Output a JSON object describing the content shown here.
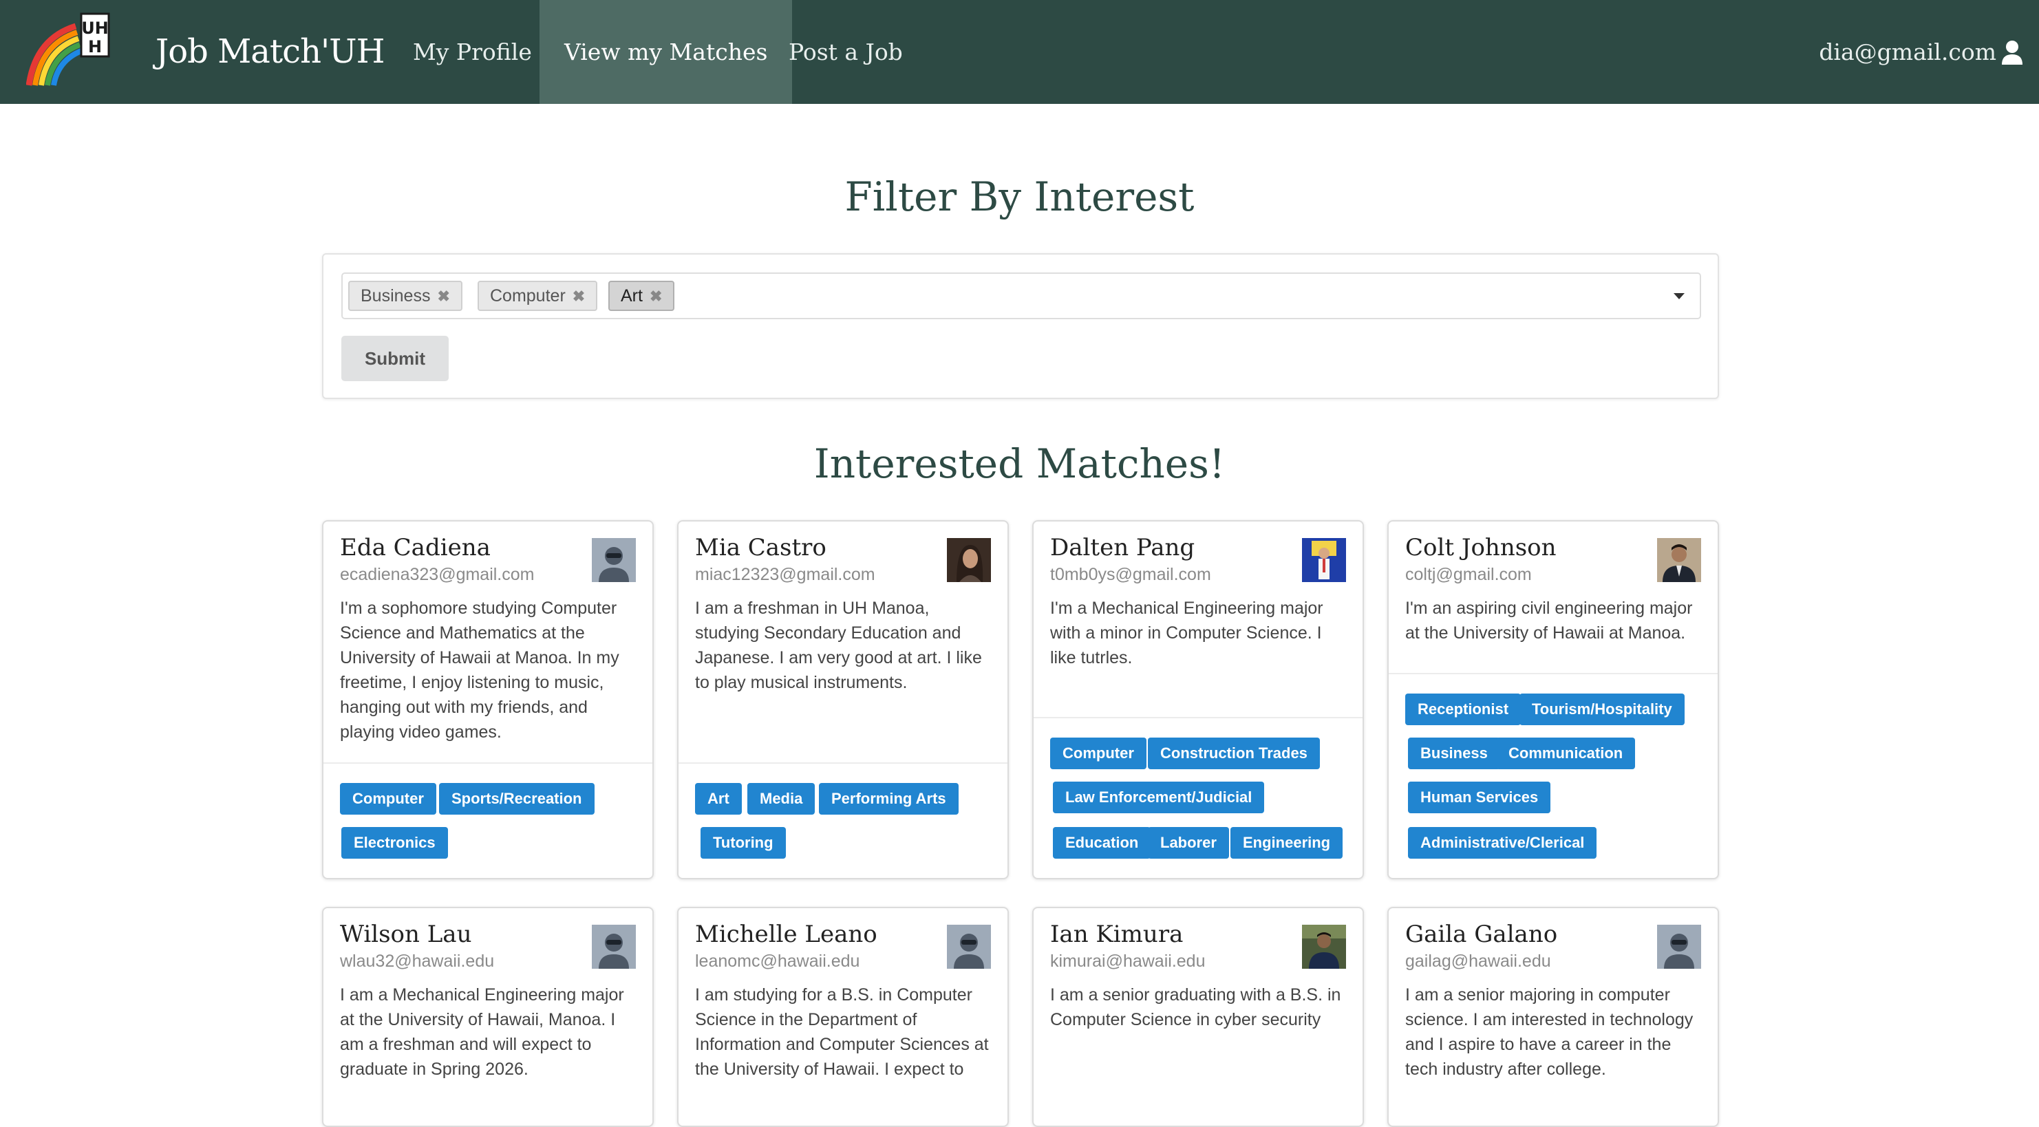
{
  "nav": {
    "brand": "Job Match'UH",
    "items": [
      {
        "label": "My Profile"
      },
      {
        "label": "View my Matches"
      },
      {
        "label": "Post a Job"
      }
    ],
    "user_email": "dia@gmail.com",
    "logo_letters": "UH"
  },
  "filter": {
    "title": "Filter By Interest",
    "chips": [
      {
        "label": "Business"
      },
      {
        "label": "Computer"
      },
      {
        "label": "Art"
      }
    ],
    "submit_label": "Submit"
  },
  "matches": {
    "title": "Interested Matches!",
    "cards": [
      {
        "name": "Eda Cadiena",
        "email": "ecadiena323@gmail.com",
        "photo": "default-avatar-icon",
        "description": "I'm a sophomore studying Computer Science and Mathematics at the University of Hawaii at Manoa. In my freetime, I enjoy listening to music, hanging out with my friends, and playing video games.",
        "tags": [
          "Computer",
          "Sports/Recreation",
          "Electronics"
        ]
      },
      {
        "name": "Mia Castro",
        "email": "miac12323@gmail.com",
        "photo": "user-photo",
        "description": "I am a freshman in UH Manoa, studying Secondary Education and Japanese. I am very good at art. I like to play musical instruments.",
        "tags": [
          "Art",
          "Media",
          "Performing Arts",
          "Tutoring"
        ]
      },
      {
        "name": "Dalten Pang",
        "email": "t0mb0ys@gmail.com",
        "photo": "user-photo",
        "description": "I'm a Mechanical Engineering major with a minor in Computer Science. I like tutrles.",
        "tags": [
          "Computer",
          "Construction Trades",
          "Law Enforcement/Judicial",
          "Education",
          "Laborer",
          "Engineering"
        ]
      },
      {
        "name": "Colt Johnson",
        "email": "coltj@gmail.com",
        "photo": "user-photo",
        "description": "I'm an aspiring civil engineering major at the University of Hawaii at Manoa.",
        "tags": [
          "Receptionist",
          "Tourism/Hospitality",
          "Business",
          "Communication",
          "Human Services",
          "Administrative/Clerical"
        ]
      },
      {
        "name": "Wilson Lau",
        "email": "wlau32@hawaii.edu",
        "photo": "default-avatar-icon",
        "description": "I am a Mechanical Engineering major at the University of Hawaii, Manoa. I am a freshman and will expect to graduate in Spring 2026.",
        "tags": []
      },
      {
        "name": "Michelle Leano",
        "email": "leanomc@hawaii.edu",
        "photo": "default-avatar-icon",
        "description": "I am studying for a B.S. in Computer Science in the Department of Information and Computer Sciences at the University of Hawaii. I expect to",
        "tags": []
      },
      {
        "name": "Ian Kimura",
        "email": "kimurai@hawaii.edu",
        "photo": "user-photo",
        "description": "I am a senior graduating with a B.S. in Computer Science in cyber security",
        "tags": []
      },
      {
        "name": "Gaila Galano",
        "email": "gailag@hawaii.edu",
        "photo": "default-avatar-icon",
        "description": "I am a senior majoring in computer science. I am interested in technology and I aspire to have a career in the tech industry after college.",
        "tags": []
      }
    ]
  }
}
